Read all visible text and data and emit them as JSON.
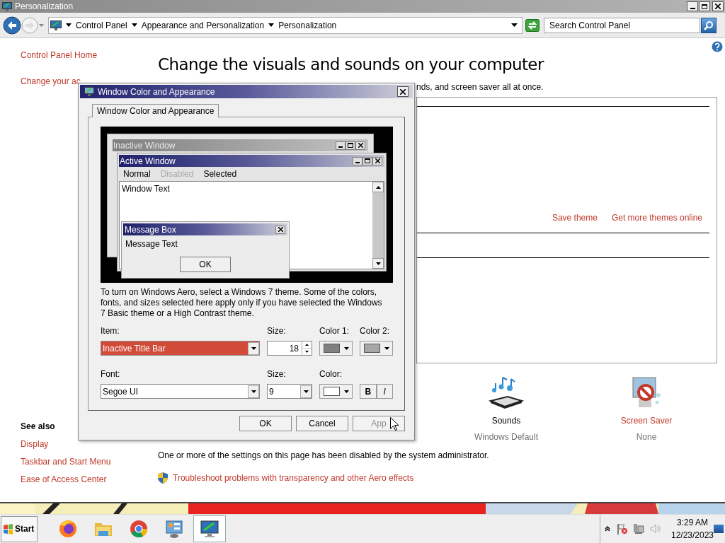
{
  "window": {
    "title": "Personalization"
  },
  "address_bar": {
    "breadcrumbs": [
      "Control Panel",
      "Appearance and Personalization",
      "Personalization"
    ]
  },
  "search": {
    "placeholder": "Search Control Panel"
  },
  "sidebar": {
    "links": [
      "Control Panel Home",
      "Change your ac"
    ],
    "see_also": {
      "heading": "See also",
      "links": [
        "Display",
        "Taskbar and Start Menu",
        "Ease of Access Center"
      ]
    }
  },
  "main": {
    "heading": "Change the visuals and sounds on your computer",
    "intro": "nds, and screen saver all at once.",
    "theme_links": [
      "Save theme",
      "Get more themes online"
    ],
    "settings": [
      {
        "kind": "sounds",
        "label": "Sounds",
        "value": "Windows Default",
        "link": false
      },
      {
        "kind": "screensaver",
        "label": "Screen Saver",
        "value": "None",
        "link": true
      }
    ],
    "notice": "One or more of the settings on this page has been disabled by the system administrator.",
    "troubleshoot_link": "Troubleshoot problems with transparency and other Aero effects"
  },
  "dialog": {
    "title": "Window Color and Appearance",
    "tabs": [
      {
        "label": "Window Color and Appearance",
        "selected": true
      }
    ],
    "preview": {
      "inactive_title": "Inactive Window",
      "active_title": "Active Window",
      "menu": [
        {
          "label": "Normal",
          "disabled": false
        },
        {
          "label": "Disabled",
          "disabled": true
        },
        {
          "label": "Selected",
          "disabled": false
        }
      ],
      "window_text": "Window Text",
      "message_title": "Message Box",
      "message_text": "Message Text",
      "message_button": "OK"
    },
    "description": "To turn on Windows Aero, select a Windows 7 theme.  Some of the colors, fonts, and sizes selected here apply only if you have selected the Windows 7 Basic theme or a High Contrast theme.",
    "item": {
      "label": "Item:",
      "value": "Inactive Title Bar"
    },
    "item_size": {
      "label": "Size:",
      "value": "18"
    },
    "color1": {
      "label": "Color 1:",
      "color": "#808080"
    },
    "color2": {
      "label": "Color 2:",
      "color": "#a6a6a6"
    },
    "font": {
      "label": "Font:",
      "value": "Segoe UI"
    },
    "font_size": {
      "label": "Size:",
      "value": "9"
    },
    "font_color": {
      "label": "Color:",
      "color": "#ffffff"
    },
    "style_buttons": [
      {
        "kind": "bold",
        "label": "B"
      },
      {
        "kind": "italic",
        "label": "I"
      }
    ],
    "buttons": [
      {
        "label": "OK",
        "disabled": false
      },
      {
        "label": "Cancel",
        "disabled": false
      },
      {
        "label": "App",
        "disabled": true
      }
    ]
  },
  "taskbar": {
    "start": "Start",
    "apps": [
      {
        "kind": "firefox",
        "selected": false
      },
      {
        "kind": "explorer",
        "selected": false
      },
      {
        "kind": "chrome",
        "selected": false
      },
      {
        "kind": "controlpanel",
        "selected": false
      },
      {
        "kind": "personalization",
        "selected": true
      }
    ],
    "clock": {
      "time": "3:29 AM",
      "date": "12/23/2023"
    }
  }
}
